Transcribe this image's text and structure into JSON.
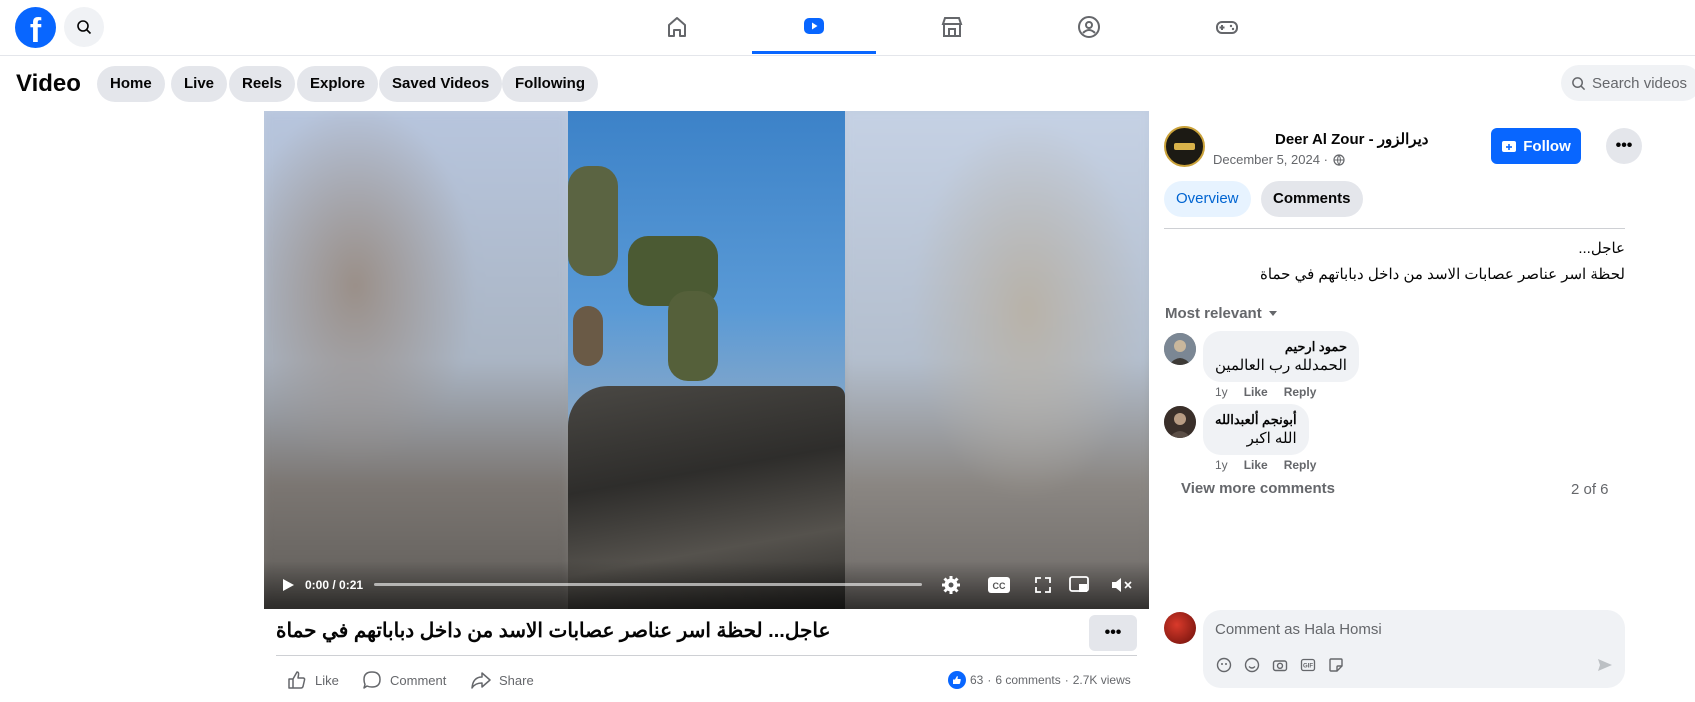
{
  "topbar": {
    "logo": "facebook-logo",
    "nav": [
      "home-icon",
      "video-icon",
      "marketplace-icon",
      "groups-icon",
      "gaming-icon"
    ],
    "active": "video-icon"
  },
  "subbar": {
    "title": "Video",
    "pills": [
      "Home",
      "Live",
      "Reels",
      "Explore",
      "Saved Videos",
      "Following"
    ],
    "search_placeholder": "Search videos"
  },
  "player": {
    "time": "0:00 / 0:21",
    "progress": 0.0
  },
  "post": {
    "title": "عاجل... لحظة اسر عناصر عصابات الاسد من داخل دباباتهم في حماة",
    "actions": {
      "like": "Like",
      "comment": "Comment",
      "share": "Share"
    },
    "stats": {
      "likes": "63",
      "comments": "6 comments",
      "views": "2.7K views"
    }
  },
  "side": {
    "page_name": "Deer Al Zour - ديرالزور",
    "date": "December 5, 2024 ·",
    "follow_label": "Follow",
    "tabs": {
      "overview": "Overview",
      "comments": "Comments"
    },
    "description_line1": "عاجل...",
    "description_line2": "لحظة اسر عناصر عصابات الاسد من داخل دباباتهم في حماة",
    "sort_label": "Most relevant",
    "comments": [
      {
        "name": "حمود ارحيم",
        "text": "الحمدلله رب العالمين",
        "age": "1y",
        "like": "Like",
        "reply": "Reply"
      },
      {
        "name": "أبونجم ألعبدالله",
        "text": "الله اكبر",
        "age": "1y",
        "like": "Like",
        "reply": "Reply"
      }
    ],
    "view_more": "View more comments",
    "count": "2 of 6",
    "compose_placeholder": "Comment as Hala Homsi"
  },
  "colors": {
    "brand": "#0866ff",
    "pill_bg": "#e4e6eb",
    "muted": "#65676b"
  }
}
